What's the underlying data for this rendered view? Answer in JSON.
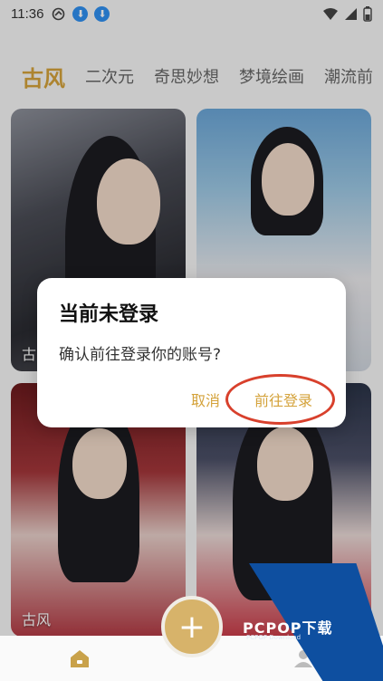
{
  "status_bar": {
    "time": "11:36"
  },
  "tabs": [
    "古风",
    "二次元",
    "奇思妙想",
    "梦境绘画",
    "潮流前"
  ],
  "cards": [
    {
      "label": "古"
    },
    {
      "label": ""
    },
    {
      "label": "古风"
    },
    {
      "label": ""
    }
  ],
  "dialog": {
    "title": "当前未登录",
    "message": "确认前往登录你的账号?",
    "cancel_label": "取消",
    "confirm_label": "前往登录"
  },
  "add_button": {
    "label": "+"
  },
  "watermark": {
    "brand": "PCPOP下载",
    "sub": "PCPOP Download"
  },
  "colors": {
    "accent": "#d4a23a",
    "highlight": "#d8402c",
    "watermark": "#0e4fa0"
  }
}
